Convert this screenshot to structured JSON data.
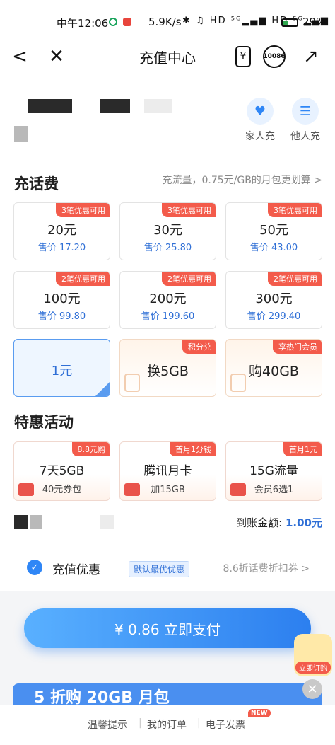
{
  "status": {
    "time": "中午12:06",
    "network": "5.9K/s",
    "icons": "✱ ♫ HD ⁵ᴳ▂▄▆ HD ⁵ᴳ▂▄▆",
    "battery": "29%"
  },
  "nav": {
    "back": "<",
    "close": "✕",
    "title": "充值中心",
    "phone_icon_text": "¥",
    "service_text": "10086",
    "share": "↗"
  },
  "quick": [
    {
      "label": "家人充",
      "icon": "♥"
    },
    {
      "label": "他人充",
      "icon": "☰"
    }
  ],
  "topup": {
    "title": "充话费",
    "flow_link": "充流量，0.75元/GB的月包更划算 >",
    "cards": [
      {
        "tag": "3笔优惠可用",
        "amount": "20元",
        "price": "售价 17.20"
      },
      {
        "tag": "3笔优惠可用",
        "amount": "30元",
        "price": "售价 25.80"
      },
      {
        "tag": "3笔优惠可用",
        "amount": "50元",
        "price": "售价 43.00"
      },
      {
        "tag": "2笔优惠可用",
        "amount": "100元",
        "price": "售价 99.80"
      },
      {
        "tag": "2笔优惠可用",
        "amount": "200元",
        "price": "售价 199.60"
      },
      {
        "tag": "2笔优惠可用",
        "amount": "300元",
        "price": "售价 299.40"
      }
    ],
    "selected": {
      "amount": "1元"
    },
    "exchange": [
      {
        "tag": "积分兑",
        "amount": "换5GB"
      },
      {
        "tag": "享热门会员",
        "amount": "购40GB"
      }
    ]
  },
  "deals": {
    "title": "特惠活动",
    "cards": [
      {
        "tag": "8.8元购",
        "amount": "7天5GB",
        "sub": "40元券包"
      },
      {
        "tag": "首月1分钱",
        "amount": "腾讯月卡",
        "sub": "加15GB"
      },
      {
        "tag": "首月1元",
        "amount": "15G流量",
        "sub": "会员6选1"
      }
    ]
  },
  "arrival": {
    "label": "到账金额: ",
    "value": "1.00元"
  },
  "discount": {
    "check": "✓",
    "label": "充值优惠",
    "badge": "默认最优优惠",
    "right": "8.6折话费折扣券 >"
  },
  "pay": {
    "label": "¥ 0.86  立即支付"
  },
  "float": {
    "label": "立即订购"
  },
  "banner": {
    "text": "5 折购 20GB 月包",
    "close": "✕"
  },
  "footer": {
    "items": [
      "温馨提示",
      "我的订单",
      "电子发票"
    ],
    "new_badge": "NEW"
  },
  "colors": {
    "accent": "#2f86f6",
    "tag_red": "#f35b4b"
  }
}
